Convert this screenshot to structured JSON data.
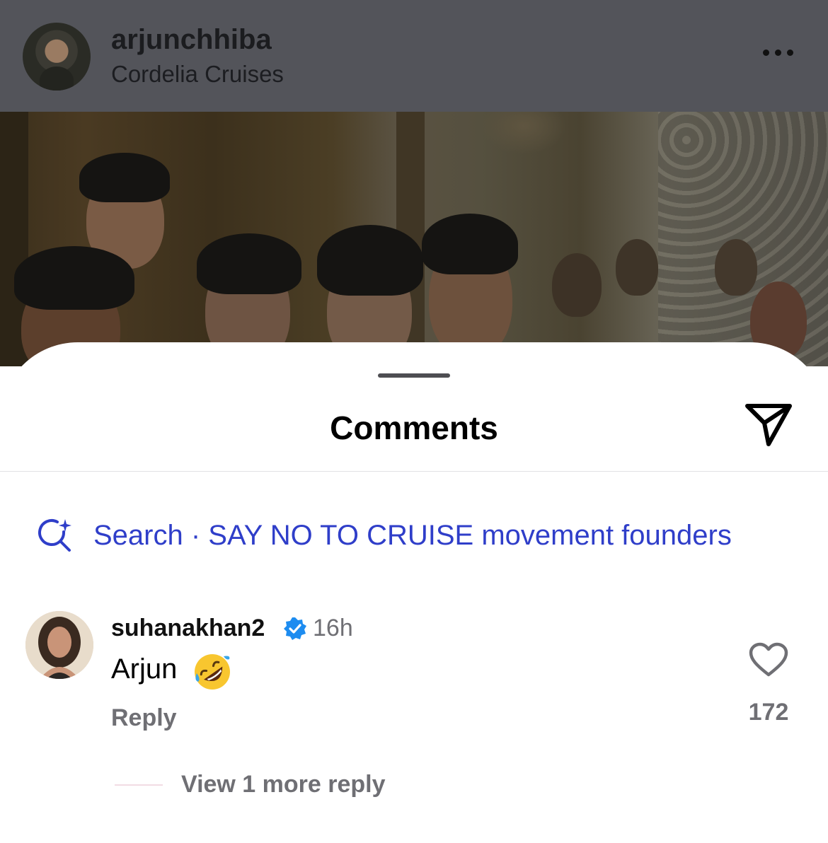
{
  "post": {
    "username": "arjunchhiba",
    "location": "Cordelia Cruises",
    "more_icon": "more-horizontal-icon"
  },
  "sheet": {
    "title": "Comments",
    "share_icon": "paper-plane-icon"
  },
  "search": {
    "icon": "ai-search-icon",
    "text": "Search · SAY NO TO CRUISE movement founders",
    "color": "#2f3ec9"
  },
  "comment": {
    "username": "suhanakhan2",
    "verified": true,
    "verified_color": "#1d8cf0",
    "time": "16h",
    "text": "Arjun",
    "emoji": "rolling-on-the-floor-laughing-emoji",
    "reply_label": "Reply",
    "like_icon": "heart-outline-icon",
    "like_count": "172",
    "view_replies_label": "View 1 more reply"
  }
}
